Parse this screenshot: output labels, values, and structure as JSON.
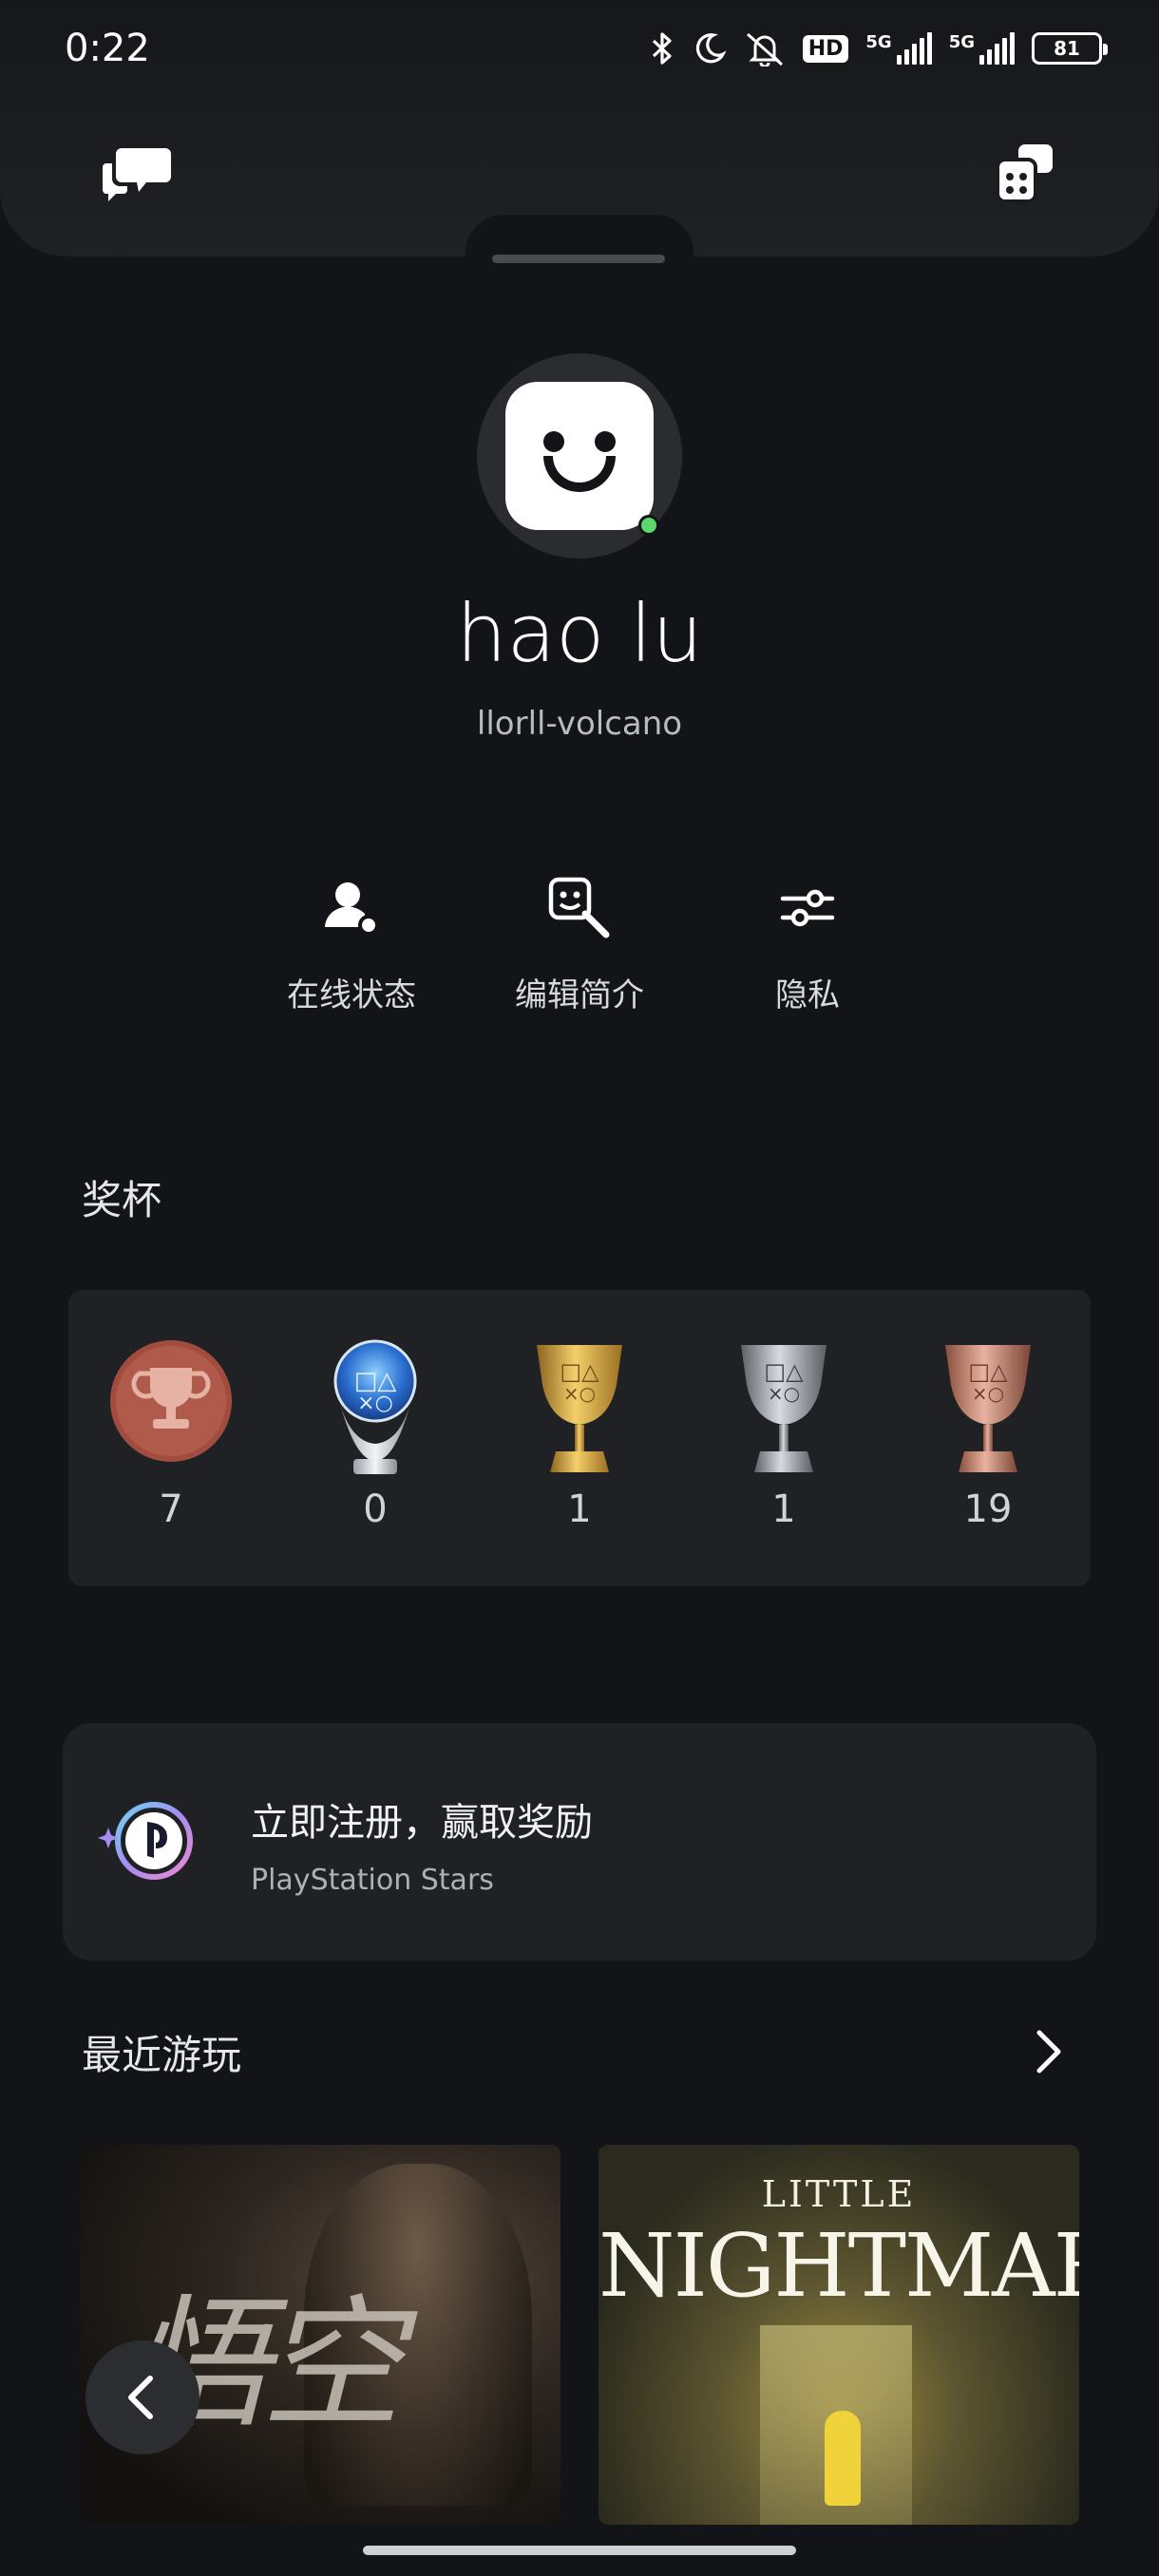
{
  "status_bar": {
    "time": "0:22",
    "hd_label": "HD",
    "net1": "5G",
    "net2": "5G",
    "battery": "81"
  },
  "profile": {
    "name": "hao lu",
    "online_id": "llorll-volcano"
  },
  "actions": [
    {
      "label": "在线状态",
      "icon": "user-status-icon"
    },
    {
      "label": "编辑简介",
      "icon": "edit-profile-icon"
    },
    {
      "label": "隐私",
      "icon": "privacy-sliders-icon"
    }
  ],
  "trophies": {
    "title": "奖杯",
    "items": [
      {
        "type": "level",
        "count": "7"
      },
      {
        "type": "platinum",
        "count": "0"
      },
      {
        "type": "gold",
        "count": "1"
      },
      {
        "type": "silver",
        "count": "1"
      },
      {
        "type": "bronze",
        "count": "19"
      }
    ]
  },
  "stars": {
    "title": "立即注册，赢取奖励",
    "subtitle": "PlayStation Stars"
  },
  "recent": {
    "title": "最近游玩"
  },
  "games": {
    "wukong_art": "悟空",
    "ln_small": "LITTLE",
    "ln_big": "NIGHTMARES"
  },
  "colors": {
    "background": "#131417",
    "card": "#202124",
    "online": "#5ad86e",
    "gold": "#d4a43a",
    "silver": "#b8bcc4",
    "bronze": "#c98a72",
    "level": "#b0574a"
  }
}
